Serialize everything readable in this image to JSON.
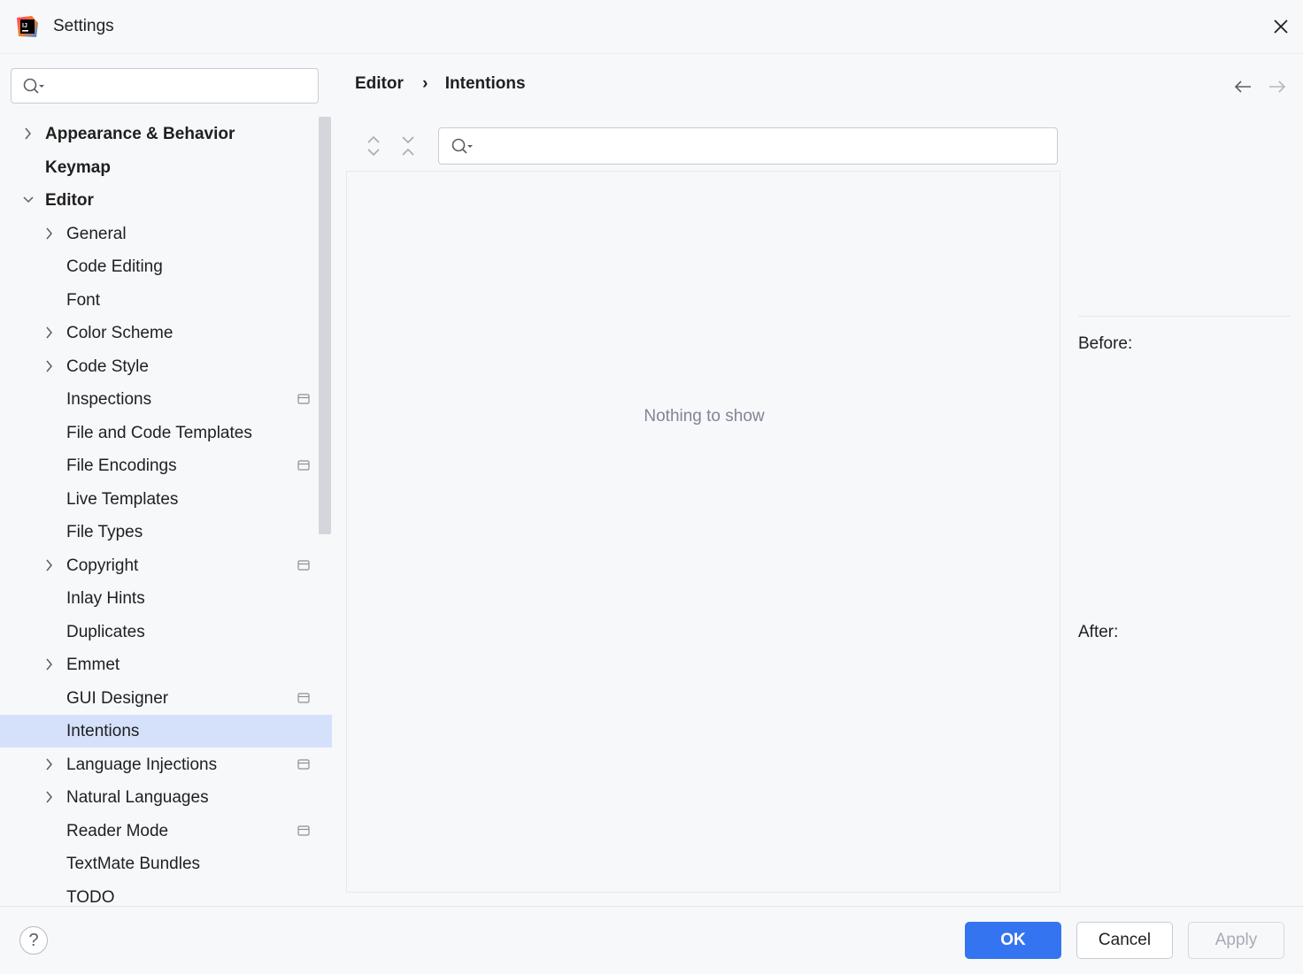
{
  "window": {
    "title": "Settings"
  },
  "sidebar": {
    "search_placeholder": "",
    "items": [
      {
        "label": "Appearance & Behavior",
        "bold": true,
        "chevron": "right",
        "level": 0,
        "project": false
      },
      {
        "label": "Keymap",
        "bold": true,
        "chevron": "none",
        "level": 0,
        "project": false
      },
      {
        "label": "Editor",
        "bold": true,
        "chevron": "down",
        "level": 0,
        "project": false
      },
      {
        "label": "General",
        "bold": false,
        "chevron": "right",
        "level": 1,
        "project": false
      },
      {
        "label": "Code Editing",
        "bold": false,
        "chevron": "none",
        "level": 1,
        "project": false
      },
      {
        "label": "Font",
        "bold": false,
        "chevron": "none",
        "level": 1,
        "project": false
      },
      {
        "label": "Color Scheme",
        "bold": false,
        "chevron": "right",
        "level": 1,
        "project": false
      },
      {
        "label": "Code Style",
        "bold": false,
        "chevron": "right",
        "level": 1,
        "project": false
      },
      {
        "label": "Inspections",
        "bold": false,
        "chevron": "none",
        "level": 1,
        "project": true
      },
      {
        "label": "File and Code Templates",
        "bold": false,
        "chevron": "none",
        "level": 1,
        "project": false
      },
      {
        "label": "File Encodings",
        "bold": false,
        "chevron": "none",
        "level": 1,
        "project": true
      },
      {
        "label": "Live Templates",
        "bold": false,
        "chevron": "none",
        "level": 1,
        "project": false
      },
      {
        "label": "File Types",
        "bold": false,
        "chevron": "none",
        "level": 1,
        "project": false
      },
      {
        "label": "Copyright",
        "bold": false,
        "chevron": "right",
        "level": 1,
        "project": true
      },
      {
        "label": "Inlay Hints",
        "bold": false,
        "chevron": "none",
        "level": 1,
        "project": false
      },
      {
        "label": "Duplicates",
        "bold": false,
        "chevron": "none",
        "level": 1,
        "project": false
      },
      {
        "label": "Emmet",
        "bold": false,
        "chevron": "right",
        "level": 1,
        "project": false
      },
      {
        "label": "GUI Designer",
        "bold": false,
        "chevron": "none",
        "level": 1,
        "project": true
      },
      {
        "label": "Intentions",
        "bold": false,
        "chevron": "none",
        "level": 1,
        "project": false,
        "selected": true
      },
      {
        "label": "Language Injections",
        "bold": false,
        "chevron": "right",
        "level": 1,
        "project": true
      },
      {
        "label": "Natural Languages",
        "bold": false,
        "chevron": "right",
        "level": 1,
        "project": false
      },
      {
        "label": "Reader Mode",
        "bold": false,
        "chevron": "none",
        "level": 1,
        "project": true
      },
      {
        "label": "TextMate Bundles",
        "bold": false,
        "chevron": "none",
        "level": 1,
        "project": false
      },
      {
        "label": "TODO",
        "bold": false,
        "chevron": "none",
        "level": 1,
        "project": false
      }
    ]
  },
  "breadcrumb": {
    "parent": "Editor",
    "separator": "›",
    "current": "Intentions"
  },
  "main": {
    "filter_placeholder": "",
    "empty_text": "Nothing to show",
    "before_label": "Before:",
    "after_label": "After:"
  },
  "footer": {
    "help_label": "?",
    "ok_label": "OK",
    "cancel_label": "Cancel",
    "apply_label": "Apply"
  },
  "colors": {
    "accent": "#3574f0",
    "selection": "#d5e1fb",
    "background": "#f7f8fa"
  }
}
